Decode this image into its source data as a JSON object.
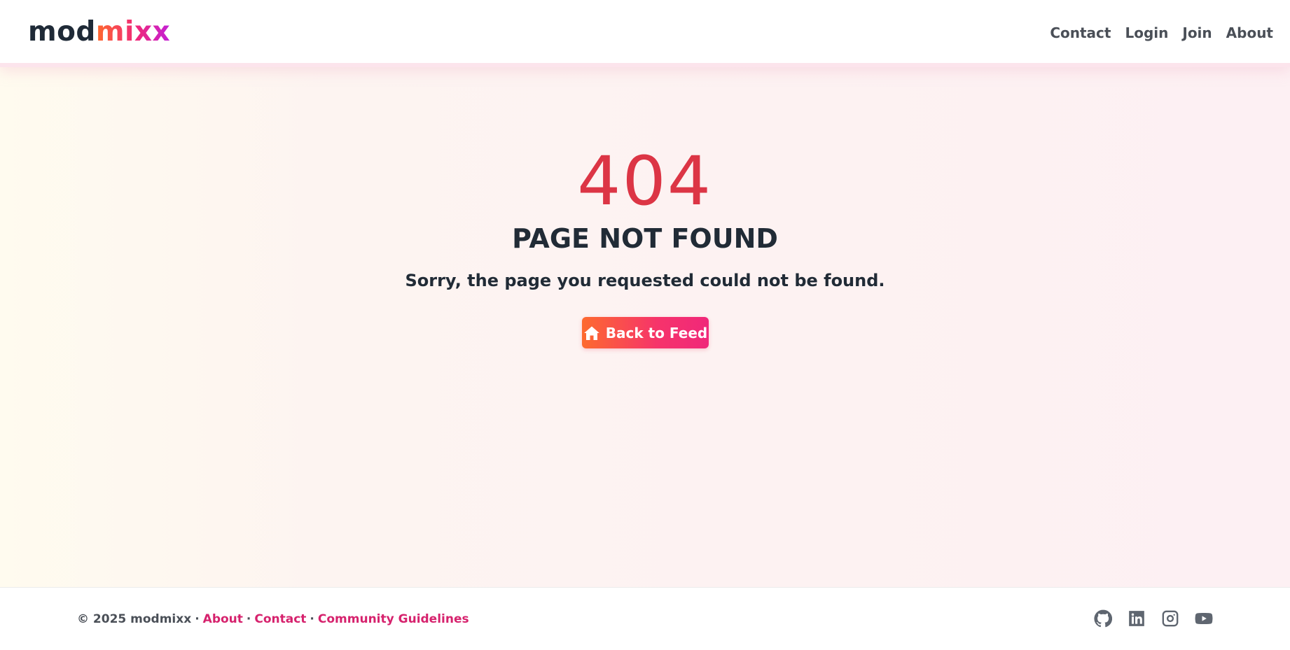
{
  "header": {
    "logo_part1": "mod",
    "logo_part2": "mixx",
    "nav": {
      "contact": "Contact",
      "login": "Login",
      "join": "Join",
      "about": "About"
    }
  },
  "main": {
    "code": "404",
    "title": "PAGE NOT FOUND",
    "message": "Sorry, the page you requested could not be found.",
    "button_label": "Back to Feed",
    "button_icon": "home-icon"
  },
  "footer": {
    "copyright": "© 2025 modmixx",
    "separator": "·",
    "links": {
      "about": "About",
      "contact": "Contact",
      "guidelines": "Community Guidelines"
    },
    "social_icons": [
      "github-icon",
      "linkedin-icon",
      "instagram-icon",
      "youtube-icon"
    ]
  },
  "colors": {
    "accent_start": "#fd6a2f",
    "accent_end": "#f0287a",
    "error_code": "#dc3545",
    "link": "#d6226d",
    "text_dark": "#212b36"
  }
}
